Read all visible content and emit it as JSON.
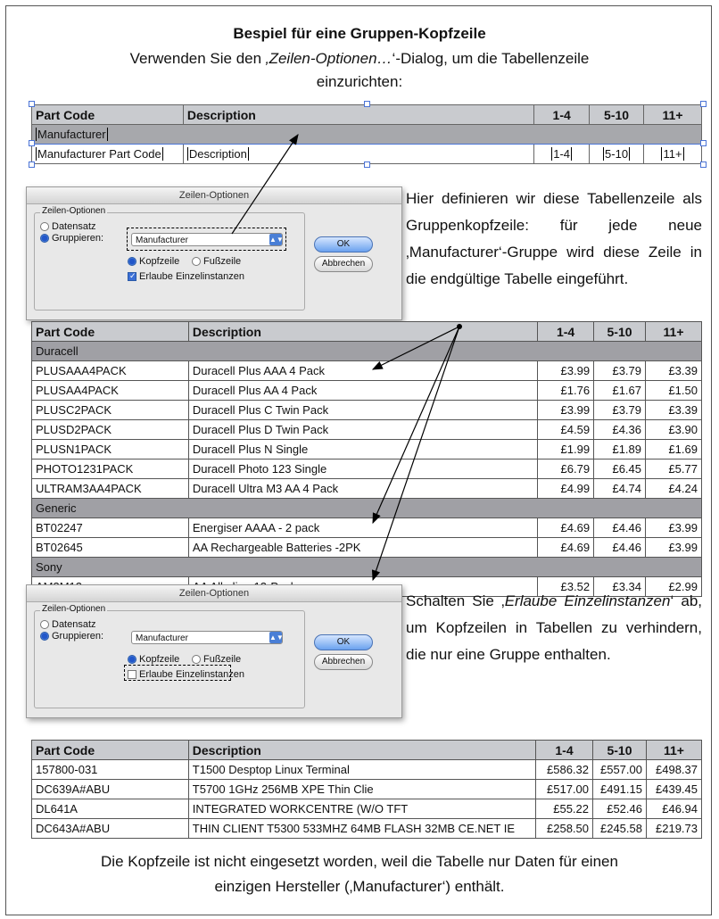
{
  "intro": {
    "title": "Bespiel für eine Gruppen-Kopfzeile",
    "line1_pre": "Verwenden Sie den ",
    "line1_em": "‚Zeilen-Optionen…",
    "line1_post": "‘-Dialog, um die Tabellenzeile",
    "line2": "einzurichten:"
  },
  "template_table": {
    "header": [
      "Part Code",
      "Description",
      "1-4",
      "5-10",
      "11+"
    ],
    "group_field": "Manufacturer",
    "row_fields": [
      "Manufacturer Part Code",
      "Description",
      "1-4",
      "5-10",
      "11+"
    ]
  },
  "dialog1": {
    "title": "Zeilen-Optionen",
    "legend": "Zeilen-Optionen",
    "radio_record": "Datensatz",
    "radio_group": "Gruppieren:",
    "select_value": "Manufacturer",
    "radio_header": "Kopfzeile",
    "radio_footer": "Fußzeile",
    "checkbox_label": "Erlaube Einzelinstanzen",
    "ok_label": "OK",
    "cancel_label": "Abbrechen"
  },
  "desc1": "Hier definieren wir diese Tabellenzeile als Gruppenkopfzeile: für jede neue ‚Manufacturer‘-Gruppe wird diese Zeile in die endgültige Tabelle eingeführt.",
  "table1": {
    "header": [
      "Part Code",
      "Description",
      "1-4",
      "5-10",
      "11+"
    ],
    "groups": [
      {
        "name": "Duracell",
        "rows": [
          [
            "PLUSAAA4PACK",
            "Duracell Plus AAA 4 Pack",
            "£3.99",
            "£3.79",
            "£3.39"
          ],
          [
            "PLUSAA4PACK",
            "Duracell Plus AA 4 Pack",
            "£1.76",
            "£1.67",
            "£1.50"
          ],
          [
            "PLUSC2PACK",
            "Duracell Plus C Twin Pack",
            "£3.99",
            "£3.79",
            "£3.39"
          ],
          [
            "PLUSD2PACK",
            "Duracell Plus D Twin Pack",
            "£4.59",
            "£4.36",
            "£3.90"
          ],
          [
            "PLUSN1PACK",
            "Duracell Plus N Single",
            "£1.99",
            "£1.89",
            "£1.69"
          ],
          [
            "PHOTO1231PACK",
            "Duracell Photo 123 Single",
            "£6.79",
            "£6.45",
            "£5.77"
          ],
          [
            "ULTRAM3AA4PACK",
            "Duracell Ultra M3 AA 4 Pack",
            "£4.99",
            "£4.74",
            "£4.24"
          ]
        ]
      },
      {
        "name": "Generic",
        "rows": [
          [
            "BT02247",
            "Energiser AAAA - 2 pack",
            "£4.69",
            "£4.46",
            "£3.99"
          ],
          [
            "BT02645",
            "AA Rechargeable Batteries -2PK",
            "£4.69",
            "£4.46",
            "£3.99"
          ]
        ]
      },
      {
        "name": "Sony",
        "rows": [
          [
            "AM3M12",
            "AA Alkaline 12-Pack",
            "£3.52",
            "£3.34",
            "£2.99"
          ]
        ]
      }
    ]
  },
  "dialog2": {
    "title": "Zeilen-Optionen",
    "legend": "Zeilen-Optionen",
    "radio_record": "Datensatz",
    "radio_group": "Gruppieren:",
    "select_value": "Manufacturer",
    "radio_header": "Kopfzeile",
    "radio_footer": "Fußzeile",
    "checkbox_label": "Erlaube Einzelinstanzen",
    "ok_label": "OK",
    "cancel_label": "Abbrechen"
  },
  "desc2_pre": "Schalten Sie ‚",
  "desc2_em": "Erlaube Einzelinstanzen",
  "desc2_post": "‘ ab, um Kopfzeilen in Tabellen zu verhindern, die nur eine Gruppe enthalten.",
  "table2": {
    "header": [
      "Part Code",
      "Description",
      "1-4",
      "5-10",
      "11+"
    ],
    "rows": [
      [
        "157800-031",
        "T1500 Desptop Linux Terminal",
        "£586.32",
        "£557.00",
        "£498.37"
      ],
      [
        "DC639A#ABU",
        "T5700 1GHz 256MB XPE Thin Clie",
        "£517.00",
        "£491.15",
        "£439.45"
      ],
      [
        "DL641A",
        "INTEGRATED WORKCENTRE (W/O TFT",
        "£55.22",
        "£52.46",
        "£46.94"
      ],
      [
        "DC643A#ABU",
        "THIN CLIENT T5300 533MHZ 64MB FLASH 32MB CE.NET IE",
        "£258.50",
        "£245.58",
        "£219.73"
      ]
    ]
  },
  "footer": {
    "line1": "Die Kopfzeile ist nicht eingesetzt worden, weil die Tabelle nur Daten für einen",
    "line2": "einzigen Hersteller (‚Manufacturer‘) enthält."
  }
}
